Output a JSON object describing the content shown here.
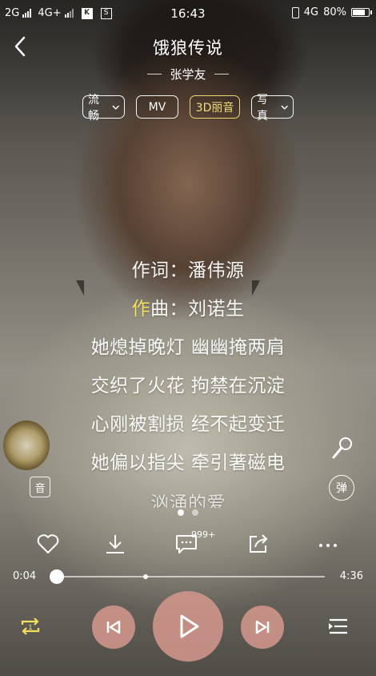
{
  "status_bar": {
    "network1": "2G",
    "network2": "4G+",
    "time": "16:43",
    "network3": "4G",
    "battery": "80%",
    "battery_level": 0.8
  },
  "header": {
    "title": "饿狼传说",
    "artist": "张学友"
  },
  "tags": [
    {
      "label": "流畅",
      "has_dropdown": true
    },
    {
      "label": "MV",
      "has_dropdown": false
    },
    {
      "label": "3D丽音",
      "has_dropdown": false,
      "active": true
    },
    {
      "label": "写真",
      "has_dropdown": true
    }
  ],
  "lyrics": {
    "lines": [
      "作词：潘伟源",
      "曲：刘诺生",
      "她熄掉晚灯 幽幽掩两肩",
      "交织了火花 拘禁在沉淀",
      "心刚被割损 经不起变迁",
      "她偏以指尖 牵引著磁电",
      "汹涌的爱"
    ],
    "current_line_prefix": "作"
  },
  "side_buttons": {
    "yin_label": "音",
    "danmu_label": "弹"
  },
  "actions": {
    "comment_count": "999+"
  },
  "progress": {
    "current": "0:04",
    "duration": "4:36",
    "fraction": 0.014,
    "marker_fraction": 0.34
  },
  "colors": {
    "accent_yellow": "#f3e05e",
    "control_pink": "#d2968c"
  },
  "icons": [
    "back-icon",
    "chevron-down-icon",
    "microphone-icon",
    "heart-icon",
    "download-icon",
    "comment-icon",
    "share-icon",
    "more-icon",
    "repeat-icon",
    "prev-icon",
    "play-icon",
    "next-icon",
    "playlist-icon"
  ]
}
